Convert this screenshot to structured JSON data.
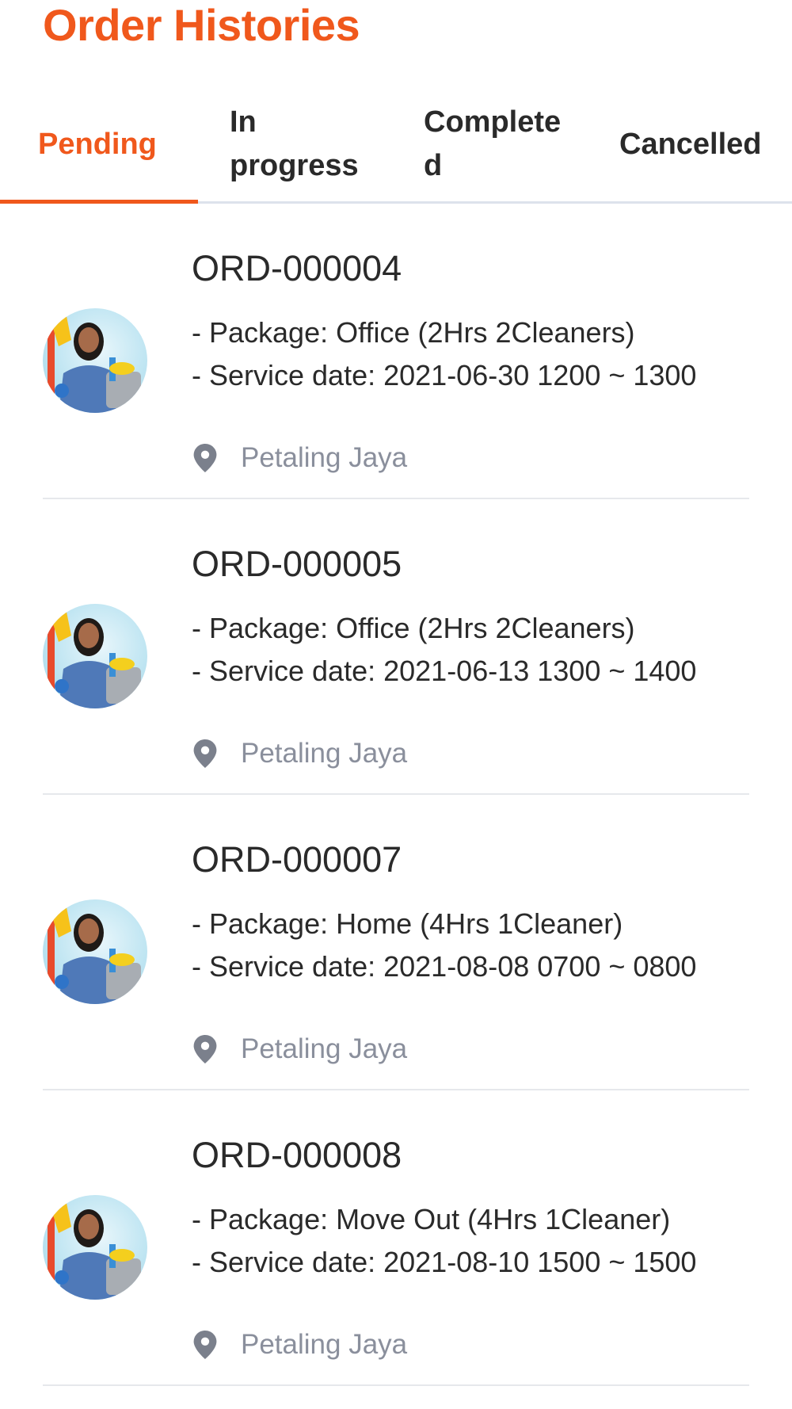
{
  "header": {
    "title": "Order Histories"
  },
  "tabs": [
    {
      "label_line1": "Pending",
      "label_line2": "",
      "active": true
    },
    {
      "label_line1": "In",
      "label_line2": "progress",
      "active": false
    },
    {
      "label_line1": "Complete",
      "label_line2": "d",
      "active": false
    },
    {
      "label_line1": "Cancelled",
      "label_line2": "",
      "active": false
    }
  ],
  "colors": {
    "accent": "#f0581c",
    "text": "#2a2a2a",
    "muted": "#8a8f9c",
    "divider": "#e6e8ec"
  },
  "icons": {
    "location": "location-pin-icon",
    "avatar": "cleaner-avatar"
  },
  "orders": [
    {
      "id": "ORD-000004",
      "package": "- Package: Office (2Hrs 2Cleaners)",
      "service_date": "- Service date: 2021-06-30 1200 ~ 1300",
      "location": "Petaling Jaya"
    },
    {
      "id": "ORD-000005",
      "package": "- Package: Office (2Hrs 2Cleaners)",
      "service_date": "- Service date: 2021-06-13 1300 ~ 1400",
      "location": "Petaling Jaya"
    },
    {
      "id": "ORD-000007",
      "package": "- Package: Home (4Hrs 1Cleaner)",
      "service_date": "- Service date: 2021-08-08 0700 ~ 0800",
      "location": "Petaling Jaya"
    },
    {
      "id": "ORD-000008",
      "package": "- Package: Move Out (4Hrs 1Cleaner)",
      "service_date": "- Service date: 2021-08-10 1500 ~ 1500",
      "location": "Petaling Jaya"
    }
  ]
}
